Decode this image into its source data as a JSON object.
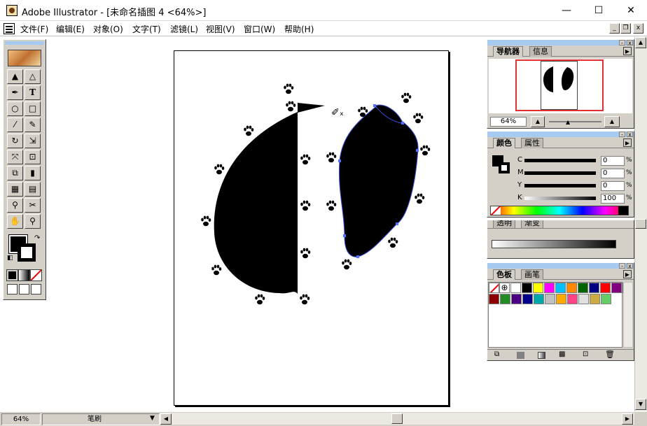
{
  "window": {
    "title": "Adobe Illustrator - [未命名插图 4 <64%>]",
    "min_label": "—",
    "max_label": "☐",
    "close_label": "✕"
  },
  "menubar": {
    "items": [
      "文件(F)",
      "编辑(E)",
      "对象(O)",
      "文字(T)",
      "滤镜(L)",
      "视图(V)",
      "窗口(W)",
      "帮助(H)"
    ],
    "mdi_min": "_",
    "mdi_restore": "❐",
    "mdi_close": "x"
  },
  "toolbox": {
    "tools": [
      {
        "name": "selection-tool",
        "glyph": "▲"
      },
      {
        "name": "direct-selection-tool",
        "glyph": "△"
      },
      {
        "name": "pen-tool",
        "glyph": "✒"
      },
      {
        "name": "type-tool",
        "glyph": "T"
      },
      {
        "name": "ellipse-tool",
        "glyph": "○"
      },
      {
        "name": "rectangle-tool",
        "glyph": "□"
      },
      {
        "name": "paintbrush-tool",
        "glyph": "⁄"
      },
      {
        "name": "pencil-tool",
        "glyph": "✎"
      },
      {
        "name": "rotate-tool",
        "glyph": "↻"
      },
      {
        "name": "scale-tool",
        "glyph": "⇲"
      },
      {
        "name": "reflect-tool",
        "glyph": "⤧"
      },
      {
        "name": "free-transform-tool",
        "glyph": "⊡"
      },
      {
        "name": "blend-tool",
        "glyph": "⧉"
      },
      {
        "name": "graph-tool",
        "glyph": "▮"
      },
      {
        "name": "gradient-mesh-tool",
        "glyph": "▦"
      },
      {
        "name": "gradient-tool",
        "glyph": "▤"
      },
      {
        "name": "eyedropper-tool",
        "glyph": "⚲"
      },
      {
        "name": "scissors-tool",
        "glyph": "✂"
      },
      {
        "name": "hand-tool",
        "glyph": "✋"
      },
      {
        "name": "zoom-tool",
        "glyph": "⚲"
      }
    ]
  },
  "navigator": {
    "tabs": [
      "导航器",
      "信息"
    ],
    "zoom": "64%"
  },
  "color": {
    "tabs": [
      "颜色",
      "属性"
    ],
    "channels": [
      {
        "label": "C",
        "value": "0",
        "unit": "%"
      },
      {
        "label": "M",
        "value": "0",
        "unit": "%"
      },
      {
        "label": "Y",
        "value": "0",
        "unit": "%"
      },
      {
        "label": "K",
        "value": "100",
        "unit": "%"
      }
    ]
  },
  "gradient": {
    "tabs": [
      "透明",
      "渐变"
    ]
  },
  "swatches": {
    "tabs": [
      "色板",
      "画笔"
    ],
    "row1": [
      "#ffffff",
      "#000000",
      "#ffff00",
      "#ff00ff",
      "#00c0ff",
      "#ff8800",
      "#006400",
      "#000080",
      "#ff0000",
      "#800080",
      "#808080"
    ],
    "row2": [
      "#8b0000",
      "#228b22",
      "#4b0082",
      "#00008b",
      "#00aaaa",
      "#c0c0c0",
      "#ffaa00",
      "#ff4488",
      "#e0e0e0",
      "#ccaa44",
      "#66cc66"
    ]
  },
  "statusbar": {
    "zoom": "64%",
    "tool": "笔刷"
  },
  "colors": {
    "accent": "#a6caf0",
    "nav_frame": "#e03030",
    "ui_face": "#d4d0c8"
  }
}
